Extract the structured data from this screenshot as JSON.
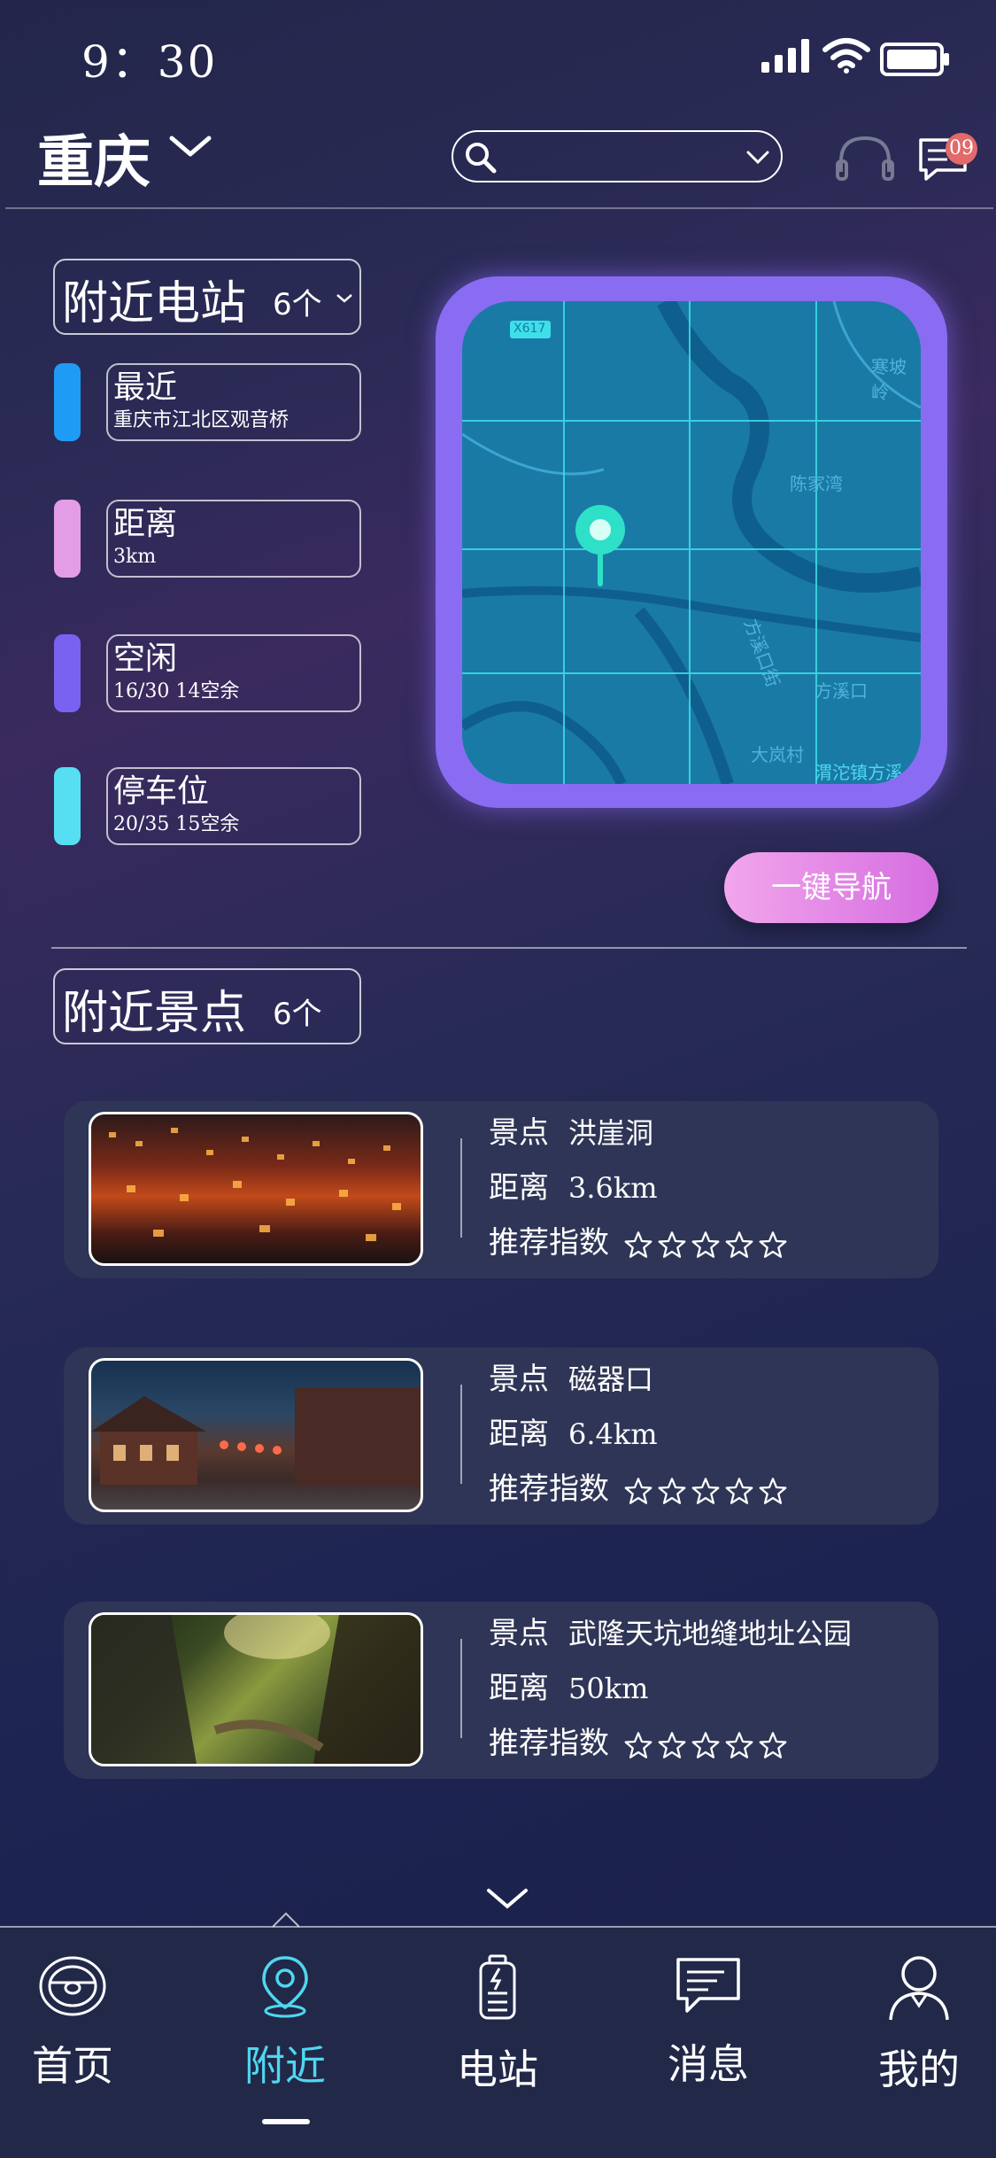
{
  "status_bar": {
    "time": "9：30"
  },
  "header": {
    "city": "重庆",
    "message_badge": "09"
  },
  "stations": {
    "title": "附近电站",
    "count": "6个",
    "filters": [
      {
        "label": "最近",
        "sub": "重庆市江北区观音桥",
        "color": "#1e9cf5"
      },
      {
        "label": "距离",
        "sub": "3km",
        "color": "#e39de6"
      },
      {
        "label": "空闲",
        "sub": "16/30  14空余",
        "color": "#7a62f0"
      },
      {
        "label": "停车位",
        "sub": "20/35  15空余",
        "color": "#56def3"
      }
    ]
  },
  "map": {
    "road_tag": "X617",
    "places": [
      "寒坡岭",
      "陈家湾",
      "方溪口街",
      "方溪口",
      "大岚村",
      "渭沱镇方溪"
    ],
    "nav_button": "一键导航"
  },
  "attractions": {
    "title": "附近景点",
    "count": "6个",
    "name_label": "景点",
    "distance_label": "距离",
    "rating_label": "推荐指数",
    "items": [
      {
        "name": "洪崖洞",
        "distance": "3.6km",
        "rating": 0
      },
      {
        "name": "磁器口",
        "distance": "6.4km",
        "rating": 0
      },
      {
        "name": "武隆天坑地缝地址公园",
        "distance": "50km",
        "rating": 0
      }
    ]
  },
  "bottom_nav": {
    "tabs": [
      {
        "label": "首页",
        "icon": "steering-wheel-icon"
      },
      {
        "label": "附近",
        "icon": "location-pin-icon",
        "active": true
      },
      {
        "label": "电站",
        "icon": "battery-icon"
      },
      {
        "label": "消息",
        "icon": "message-icon"
      },
      {
        "label": "我的",
        "icon": "person-icon"
      }
    ]
  },
  "colors": {
    "accent": "#4fd7f0",
    "map_frame": "#8a6cf2",
    "nav_button": "#e08fe6",
    "card": "#2f3556"
  }
}
